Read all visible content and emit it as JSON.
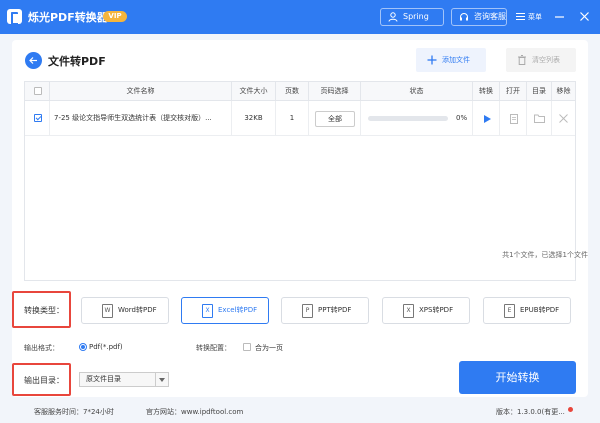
{
  "app": {
    "title": "烁光PDF转换器",
    "vip": "VIP"
  },
  "header": {
    "user": "Spring",
    "support": "咨询客服",
    "menu": "菜单"
  },
  "page": {
    "title": "文件转PDF",
    "add_file": "添加文件",
    "clear_list": "清空列表"
  },
  "table": {
    "headers": [
      "文件名称",
      "文件大小",
      "页数",
      "页码选择",
      "状态",
      "转换",
      "打开",
      "目录",
      "移除"
    ],
    "rows": [
      {
        "name": "7-25 级论文指导师生双选统计表（提交核对版）...",
        "size": "32KB",
        "pages": "1",
        "range": "全部",
        "progress": 0,
        "progress_text": "0%"
      }
    ]
  },
  "summary": "共1个文件，已选择1个文件",
  "convert_type": {
    "label": "转换类型：",
    "options": [
      {
        "label": "Word转PDF",
        "icon": "W"
      },
      {
        "label": "Excel转PDF",
        "icon": "X",
        "active": true
      },
      {
        "label": "PPT转PDF",
        "icon": "P"
      },
      {
        "label": "XPS转PDF",
        "icon": "X"
      },
      {
        "label": "EPUB转PDF",
        "icon": "E"
      }
    ]
  },
  "output": {
    "format_label": "输出格式：",
    "format_value": "Pdf(*.pdf)",
    "config_label": "转换配置：",
    "merge_label": "合为一页",
    "dir_label": "输出目录：",
    "dir_value": "原文件目录"
  },
  "start_button": "开始转换",
  "footer": {
    "service": "客服服务时间：7*24小时",
    "website": "官方网站：www.ipdftool.com",
    "version": "版本：1.3.0.0(有更..."
  },
  "colors": {
    "primary": "#2f7bf2",
    "highlight": "#e8463c",
    "vip": "#f5b53c"
  }
}
